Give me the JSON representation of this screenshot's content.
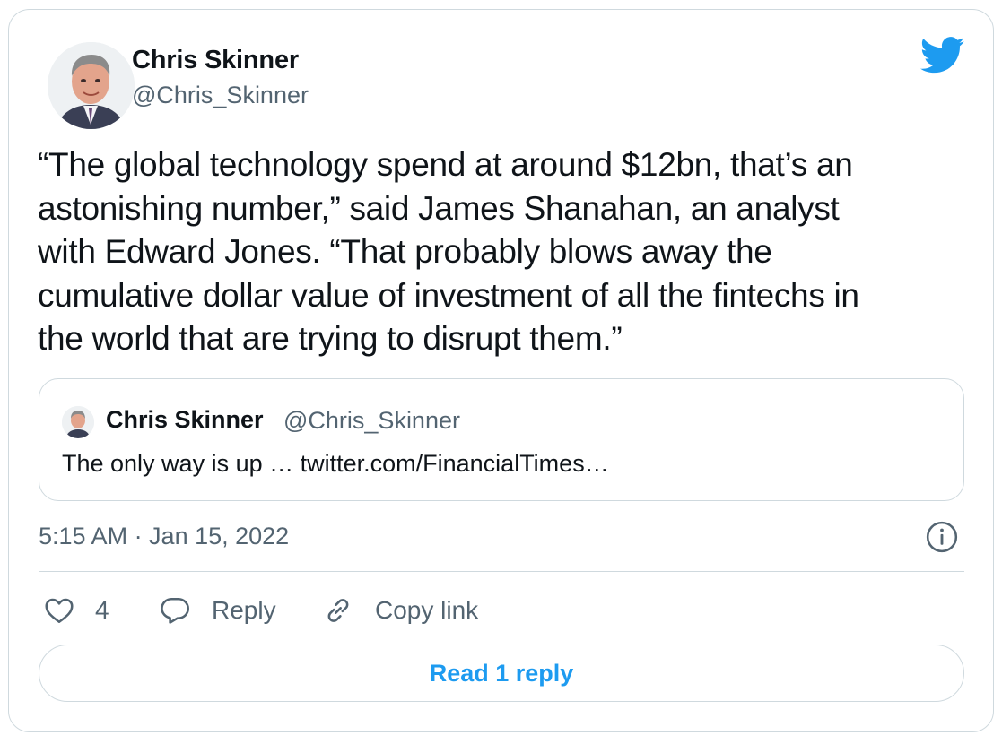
{
  "author": {
    "name": "Chris Skinner",
    "handle": "@Chris_Skinner"
  },
  "tweet": {
    "lines": [
      "“The global technology spend at around $12bn, that’s an",
      "astonishing number,” said James Shanahan, an analyst",
      "with Edward Jones. “That probably blows away the",
      "cumulative dollar value of investment of all the fintechs in",
      "the world that are trying to disrupt them.”"
    ]
  },
  "quoted_tweet": {
    "name": "Chris Skinner",
    "handle": "@Chris_Skinner",
    "text": "The only way is up … twitter.com/FinancialTimes…"
  },
  "timestamp": "5:15 AM · Jan 15, 2022",
  "actions": {
    "like_count": "4",
    "reply_label": "Reply",
    "copy_label": "Copy link"
  },
  "read_reply_label": "Read 1 reply",
  "icons": {
    "brand": "twitter-bird-icon",
    "info": "info-icon",
    "like": "heart-icon",
    "reply": "speech-bubble-icon",
    "copy": "link-icon"
  },
  "colors": {
    "brand_blue": "#1d9bf0",
    "text_primary": "#0f1419",
    "text_secondary": "#536471",
    "border": "#cfd9de"
  }
}
